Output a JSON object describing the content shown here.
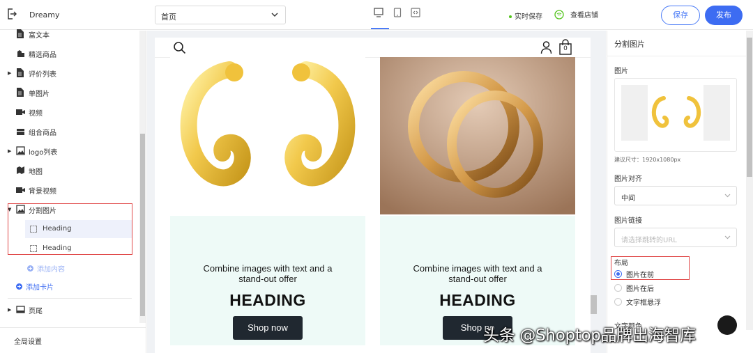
{
  "app": {
    "name": "Dreamy"
  },
  "toolbar": {
    "page_select": "首页",
    "autosave": "实时保存",
    "view_store": "查看店铺",
    "save": "保存",
    "publish": "发布"
  },
  "sidebar": {
    "items": [
      {
        "label": "富文本",
        "icon": "document-icon",
        "caret": false
      },
      {
        "label": "精选商品",
        "icon": "product-icon",
        "caret": false
      },
      {
        "label": "评价列表",
        "icon": "document-icon",
        "caret": true
      },
      {
        "label": "单图片",
        "icon": "document-icon",
        "caret": false
      },
      {
        "label": "视频",
        "icon": "video-icon",
        "caret": false
      },
      {
        "label": "组合商品",
        "icon": "bundle-icon",
        "caret": false
      },
      {
        "label": "logo列表",
        "icon": "image-icon",
        "caret": true
      },
      {
        "label": "地图",
        "icon": "map-icon",
        "caret": false
      },
      {
        "label": "背景视频",
        "icon": "video-icon",
        "caret": false
      },
      {
        "label": "分割图片",
        "icon": "image-icon",
        "caret": "open"
      }
    ],
    "children": [
      "Heading",
      "Heading"
    ],
    "add_content": "添加内容",
    "add_card": "添加卡片",
    "footer": "页尾",
    "global_settings": "全局设置"
  },
  "preview": {
    "cards": [
      {
        "subtitle": "Combine images with text and a stand-out offer",
        "heading": "HEADING",
        "button": "Shop now"
      },
      {
        "subtitle": "Combine images with text and a stand-out offer",
        "heading": "HEADING",
        "button": "Shop no"
      }
    ],
    "cart_count": "0"
  },
  "settings": {
    "title": "分割图片",
    "image_label": "图片",
    "size_hint": "建议尺寸：1920x1080px",
    "align_label": "图片对齐",
    "align_value": "中间",
    "link_label": "图片链接",
    "link_placeholder": "请选择跳转的URL",
    "layout_label": "布局",
    "layout_options": [
      "图片在前",
      "图片在后",
      "文字框悬浮"
    ],
    "layout_selected": 0,
    "text_color_label": "文字颜色"
  },
  "watermark": "头条 @Shoptop品牌出海智库",
  "colors": {
    "accent": "#3d6cf2",
    "highlight": "#e04848",
    "card_bg": "#eefaf7"
  }
}
